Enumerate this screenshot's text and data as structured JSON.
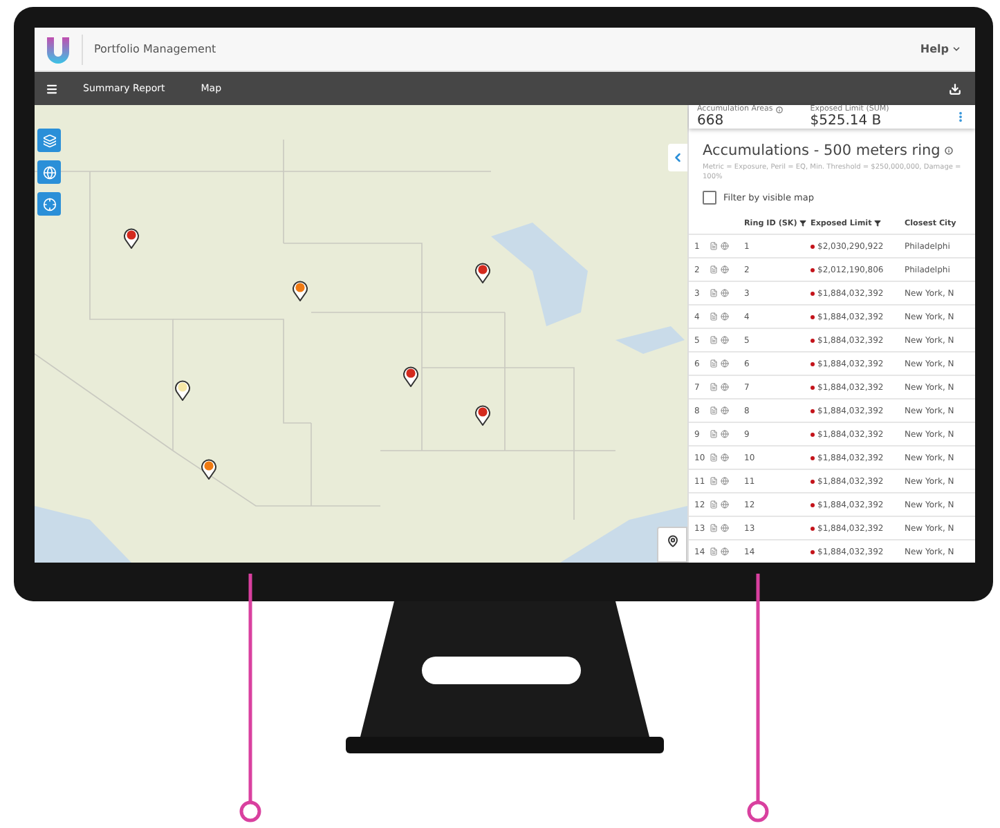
{
  "header": {
    "app_title": "Portfolio Management",
    "help": "Help"
  },
  "nav": {
    "items": [
      {
        "label": "Summary Report"
      },
      {
        "label": "Map"
      }
    ]
  },
  "map": {
    "pins": [
      {
        "color": "#d42a1e"
      },
      {
        "color": "#f07a12"
      },
      {
        "color": "#f6e7a6"
      },
      {
        "color": "#f07a12"
      },
      {
        "color": "#d42a1e"
      },
      {
        "color": "#d42a1e"
      },
      {
        "color": "#d42a1e"
      }
    ]
  },
  "summary": {
    "stats": [
      {
        "label": "Accumulation Areas",
        "value": "668",
        "info": true
      },
      {
        "label": "Exposed Limit (SUM)",
        "value": "$525.14 B",
        "info": false
      }
    ]
  },
  "panel": {
    "title": "Accumulations - 500 meters ring",
    "subtitle": "Metric = Exposure, Peril = EQ, Min. Threshold = $250,000,000, Damage = 100%",
    "filter": {
      "label": "Filter by visible map",
      "checked": false
    }
  },
  "table": {
    "columns": [
      {
        "label": "Ring ID (SK)",
        "filter": true
      },
      {
        "label": "Exposed Limit",
        "filter": true
      },
      {
        "label": "Closest City",
        "filter": false
      }
    ],
    "rows": [
      {
        "index": "1",
        "ring_id": "1",
        "exposed_limit": "$2,030,290,922",
        "city": "Philadelphi"
      },
      {
        "index": "2",
        "ring_id": "2",
        "exposed_limit": "$2,012,190,806",
        "city": "Philadelphi"
      },
      {
        "index": "3",
        "ring_id": "3",
        "exposed_limit": "$1,884,032,392",
        "city": "New York, N"
      },
      {
        "index": "4",
        "ring_id": "4",
        "exposed_limit": "$1,884,032,392",
        "city": "New York, N"
      },
      {
        "index": "5",
        "ring_id": "5",
        "exposed_limit": "$1,884,032,392",
        "city": "New York, N"
      },
      {
        "index": "6",
        "ring_id": "6",
        "exposed_limit": "$1,884,032,392",
        "city": "New York, N"
      },
      {
        "index": "7",
        "ring_id": "7",
        "exposed_limit": "$1,884,032,392",
        "city": "New York, N"
      },
      {
        "index": "8",
        "ring_id": "8",
        "exposed_limit": "$1,884,032,392",
        "city": "New York, N"
      },
      {
        "index": "9",
        "ring_id": "9",
        "exposed_limit": "$1,884,032,392",
        "city": "New York, N"
      },
      {
        "index": "10",
        "ring_id": "10",
        "exposed_limit": "$1,884,032,392",
        "city": "New York, N"
      },
      {
        "index": "11",
        "ring_id": "11",
        "exposed_limit": "$1,884,032,392",
        "city": "New York, N"
      },
      {
        "index": "12",
        "ring_id": "12",
        "exposed_limit": "$1,884,032,392",
        "city": "New York, N"
      },
      {
        "index": "13",
        "ring_id": "13",
        "exposed_limit": "$1,884,032,392",
        "city": "New York, N"
      },
      {
        "index": "14",
        "ring_id": "14",
        "exposed_limit": "$1,884,032,392",
        "city": "New York, N"
      }
    ]
  }
}
